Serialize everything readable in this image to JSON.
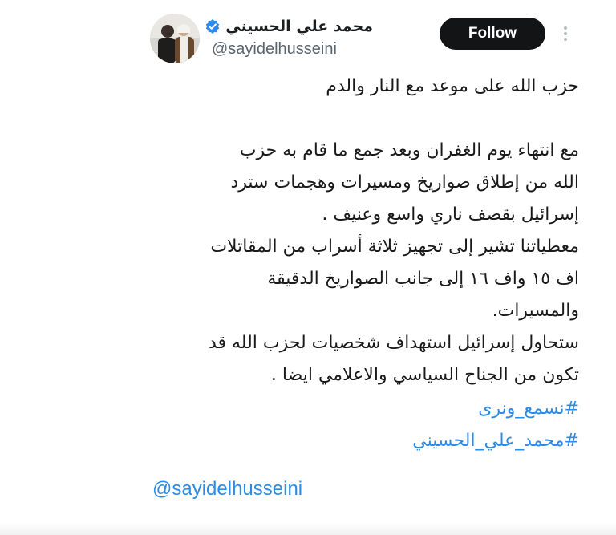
{
  "header": {
    "display_name": "محمد علي الحسيني",
    "handle": "@sayidelhusseini",
    "follow_label": "Follow",
    "verified_icon": "verified-badge-icon",
    "more_icon": "more-vertical-icon",
    "accent_color": "#2c8be6"
  },
  "tweet": {
    "title_line": "حزب الله على موعد مع النار والدم",
    "lines": [
      "مع انتهاء يوم الغفران وبعد جمع ما قام به حزب",
      "الله من إطلاق صواريخ ومسيرات وهجمات سترد",
      "إسرائيل بقصف ناري واسع وعنيف .",
      "معطياتنا تشير إلى تجهيز ثلاثة أسراب من المقاتلات",
      "اف ١٥ واف ١٦ إلى جانب الصواريخ الدقيقة",
      "والمسيرات.",
      "ستحاول إسرائيل استهداف شخصيات لحزب الله قد",
      "تكون من الجناح السياسي والاعلامي ايضا ."
    ],
    "hashtags": [
      "#نسمع_ونرى",
      "#محمد_علي_الحسيني"
    ],
    "mention": "@sayidelhusseini"
  }
}
